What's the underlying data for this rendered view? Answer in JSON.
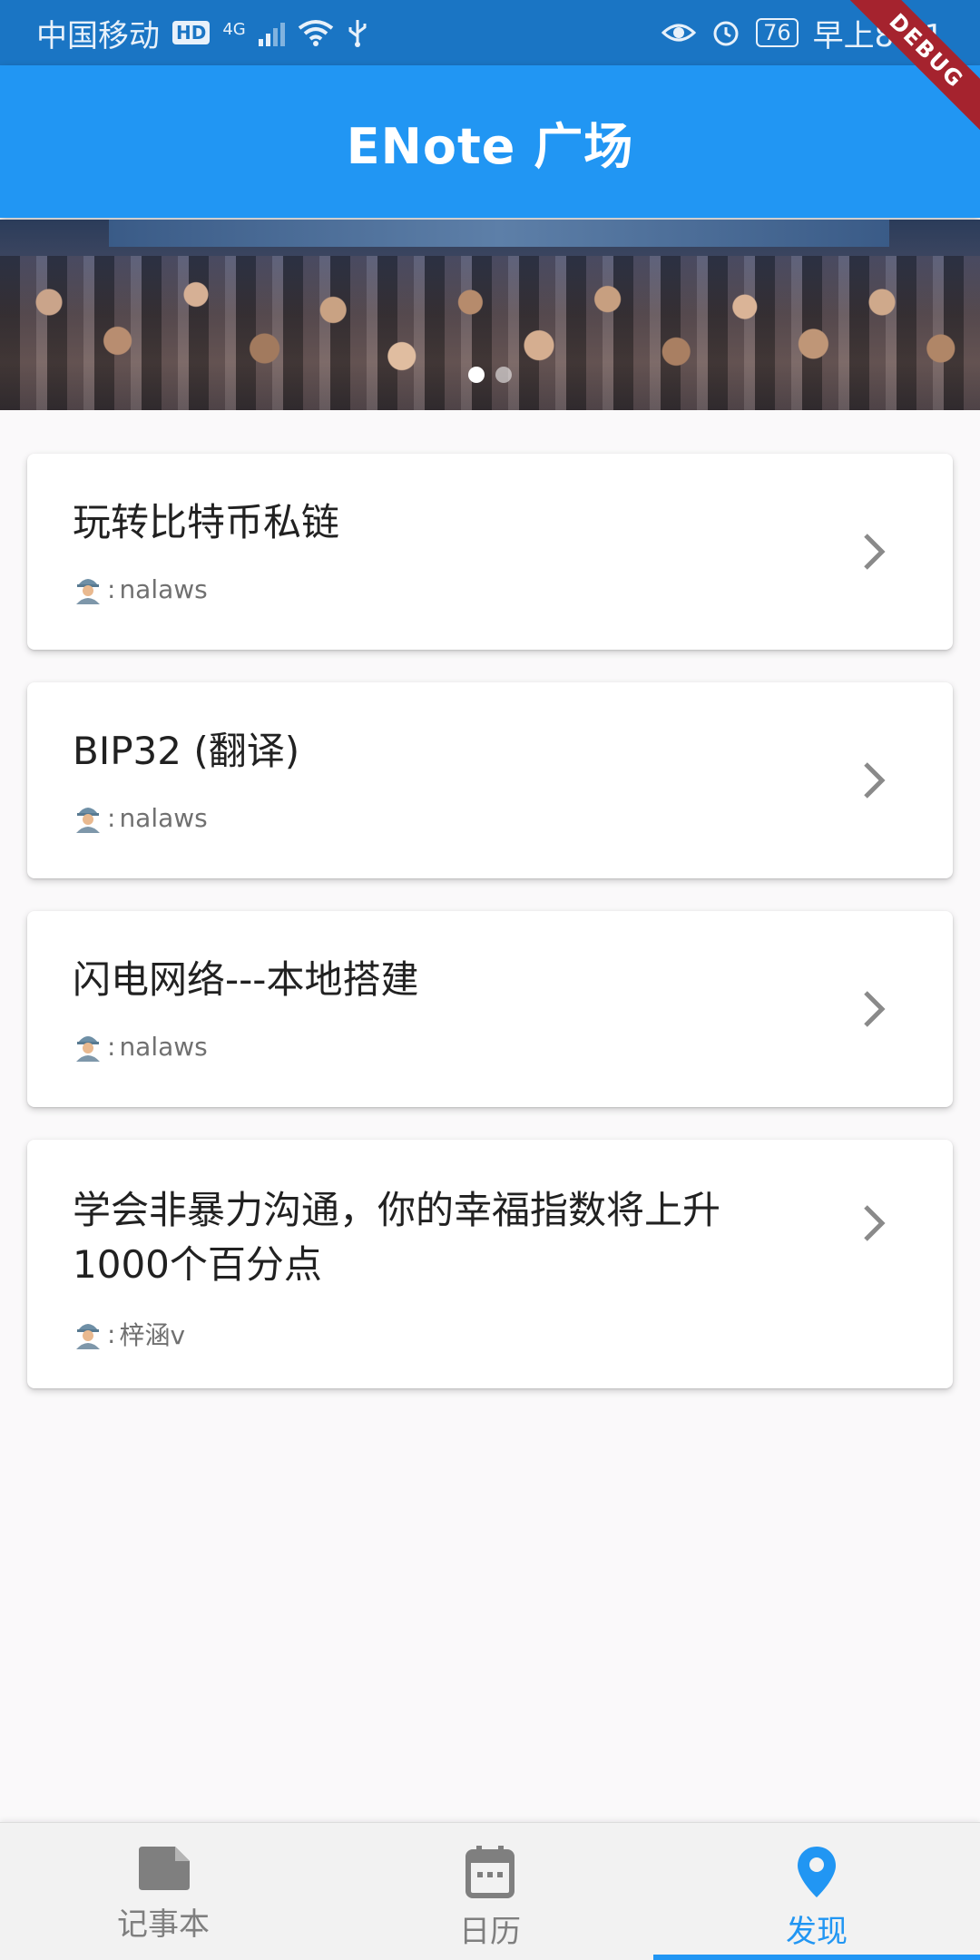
{
  "status_bar": {
    "carrier": "中国移动",
    "hd": "HD",
    "network": "4G",
    "battery": "76",
    "time": "早上8:41"
  },
  "debug_banner": "DEBUG",
  "app_bar": {
    "title": "ENote 广场"
  },
  "carousel": {
    "page_count": 2,
    "active_index": 0
  },
  "articles": [
    {
      "title": "玩转比特币私链",
      "author_prefix": ": ",
      "author": "nalaws"
    },
    {
      "title": "BIP32 (翻译)",
      "author_prefix": ": ",
      "author": "nalaws"
    },
    {
      "title": "闪电网络---本地搭建",
      "author_prefix": ": ",
      "author": "nalaws"
    },
    {
      "title": "学会非暴力沟通，你的幸福指数将上升1000个百分点",
      "author_prefix": ": ",
      "author": "梓涵v"
    }
  ],
  "bottom_nav": {
    "items": [
      {
        "label": "记事本",
        "icon": "notebook-icon",
        "active": false
      },
      {
        "label": "日历",
        "icon": "calendar-icon",
        "active": false
      },
      {
        "label": "发现",
        "icon": "location-pin-icon",
        "active": true
      }
    ]
  },
  "colors": {
    "primary": "#2196f3",
    "status_bar": "#1a75c4",
    "inactive": "#7f7f7f",
    "debug_ribbon": "#a5232e"
  }
}
